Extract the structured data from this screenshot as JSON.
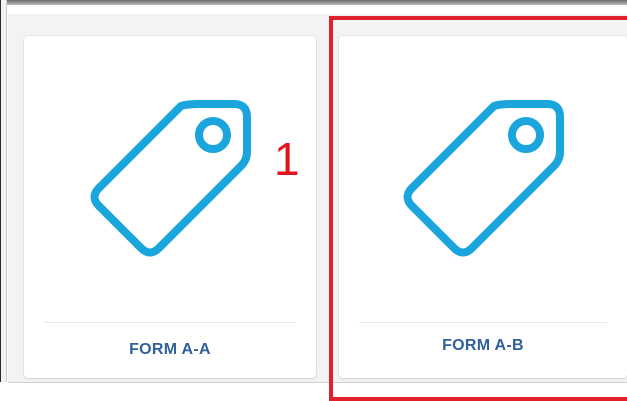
{
  "cards": [
    {
      "label": "FORM A-A",
      "icon": "tag-icon"
    },
    {
      "label": "FORM A-B",
      "icon": "tag-icon"
    }
  ],
  "annotation": {
    "number": "1",
    "color": "#e3131b"
  },
  "colors": {
    "icon": "#1aa6dc",
    "label": "#31609a",
    "highlight": "#e0202a"
  }
}
